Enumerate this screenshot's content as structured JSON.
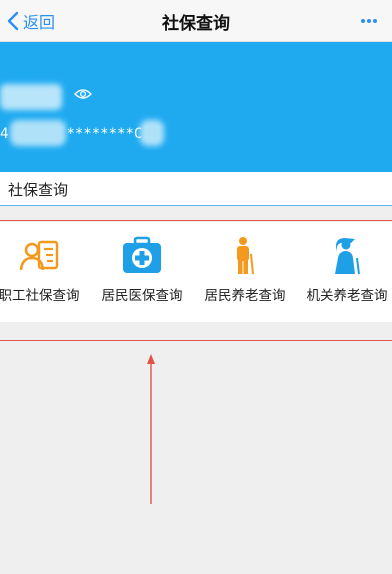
{
  "nav": {
    "back_label": "返回",
    "title": "社保查询",
    "more_icon": "more-dots-icon"
  },
  "banner": {
    "id_prefix": "4",
    "id_masked": "********C"
  },
  "section": {
    "title": "社保查询"
  },
  "services": [
    {
      "label": "职工社保查询",
      "icon": "worker-profile-icon",
      "color": "#f39a1e"
    },
    {
      "label": "居民医保查询",
      "icon": "medical-kit-icon",
      "color": "#1f9fe6"
    },
    {
      "label": "居民养老查询",
      "icon": "elder-person-icon",
      "color": "#f39a1e"
    },
    {
      "label": "机关养老查询",
      "icon": "elder-cane-icon",
      "color": "#1f9fe6"
    }
  ],
  "colors": {
    "accent": "#2d8ff3",
    "banner": "#1faaf0",
    "annotation": "#e1534b"
  }
}
